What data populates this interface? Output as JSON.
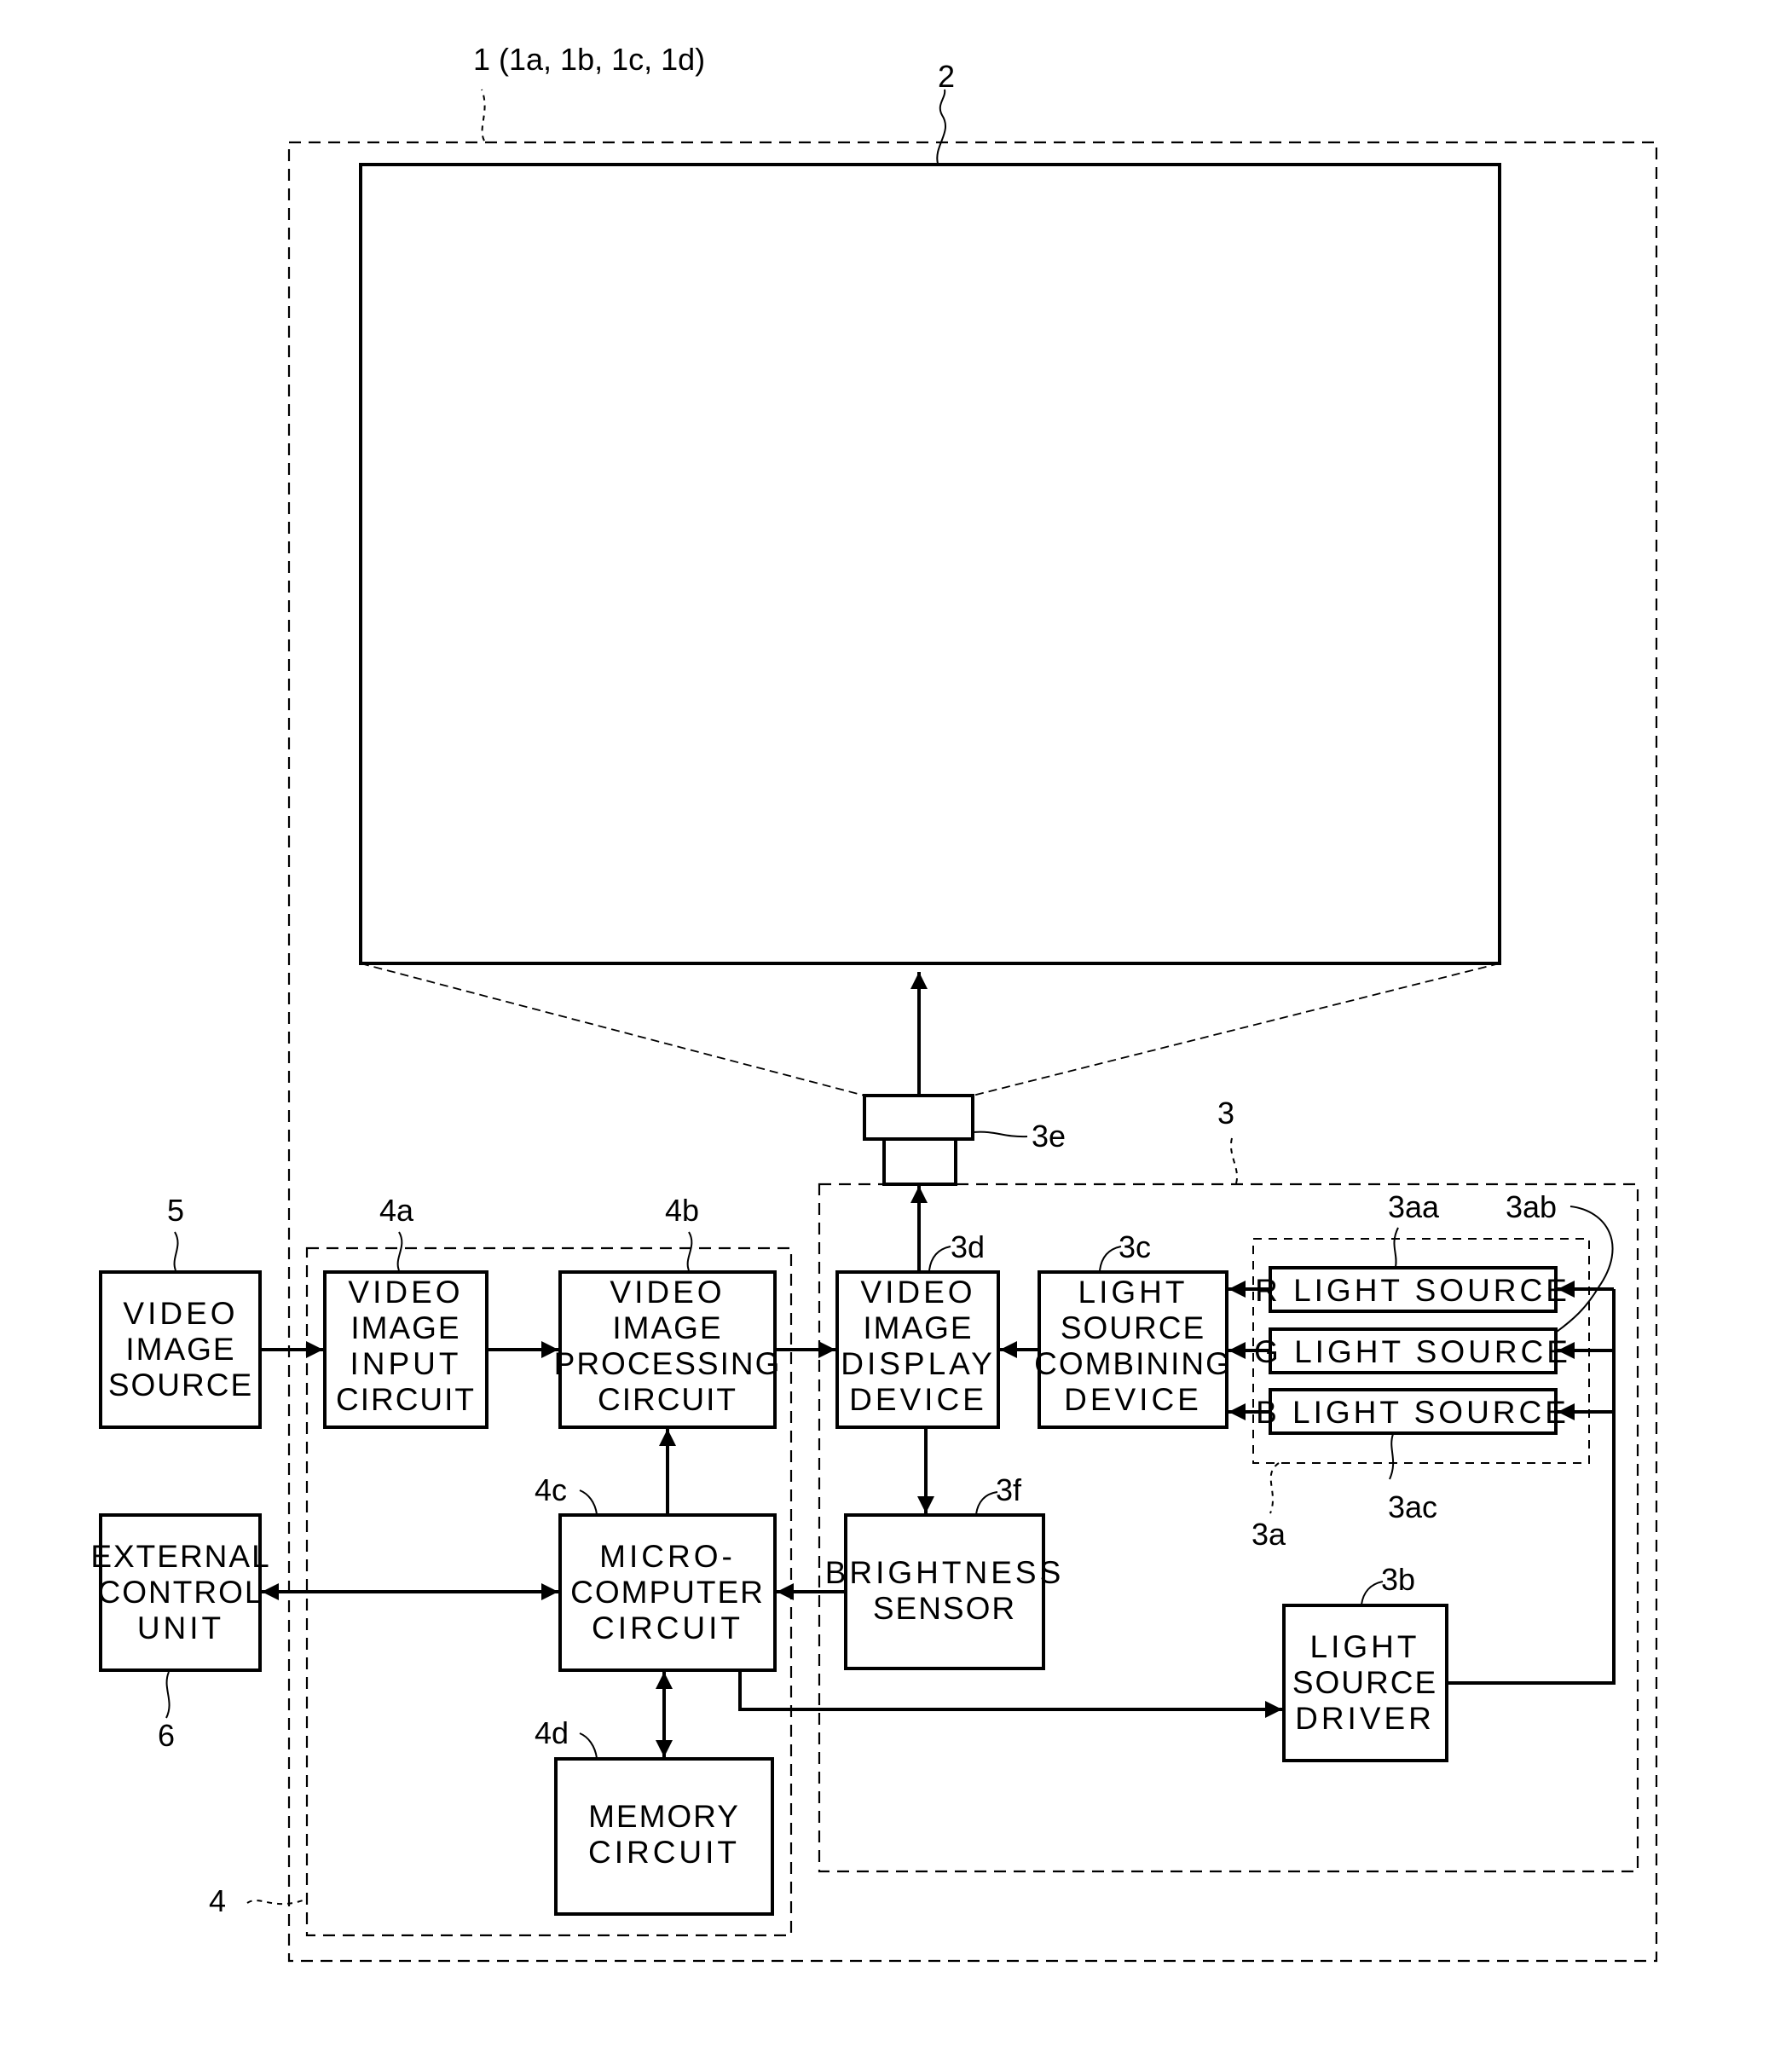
{
  "figure": {
    "title_ref": "1 (1a, 1b, 1c, 1d)"
  },
  "refs": {
    "screen": "2",
    "optical_unit": "3",
    "light_source_unit": "3a",
    "r_light": "3aa",
    "g_light": "3ab",
    "b_light": "3ac",
    "driver": "3b",
    "combiner": "3c",
    "display": "3d",
    "lens": "3e",
    "sensor": "3f",
    "control_unit": "4",
    "input": "4a",
    "processing": "4b",
    "micro": "4c",
    "memory": "4d",
    "source": "5",
    "external": "6"
  },
  "blocks": {
    "video_source": [
      "VIDEO",
      "IMAGE",
      "SOURCE"
    ],
    "input_circuit": [
      "VIDEO",
      "IMAGE",
      "INPUT",
      "CIRCUIT"
    ],
    "processing_circuit": [
      "VIDEO",
      "IMAGE",
      "PROCESSING",
      "CIRCUIT"
    ],
    "display_device": [
      "VIDEO",
      "IMAGE",
      "DISPLAY",
      "DEVICE"
    ],
    "combining_device": [
      "LIGHT",
      "SOURCE",
      "COMBINING",
      "DEVICE"
    ],
    "r_light": "R LIGHT SOURCE",
    "g_light": "G LIGHT SOURCE",
    "b_light": "B LIGHT SOURCE",
    "external_control": [
      "EXTERNAL",
      "CONTROL",
      "UNIT"
    ],
    "microcomputer": [
      "MICRO-",
      "COMPUTER",
      "CIRCUIT"
    ],
    "brightness_sensor": [
      "BRIGHTNESS",
      "SENSOR"
    ],
    "light_driver": [
      "LIGHT",
      "SOURCE",
      "DRIVER"
    ],
    "memory_circuit": [
      "MEMORY",
      "CIRCUIT"
    ]
  }
}
